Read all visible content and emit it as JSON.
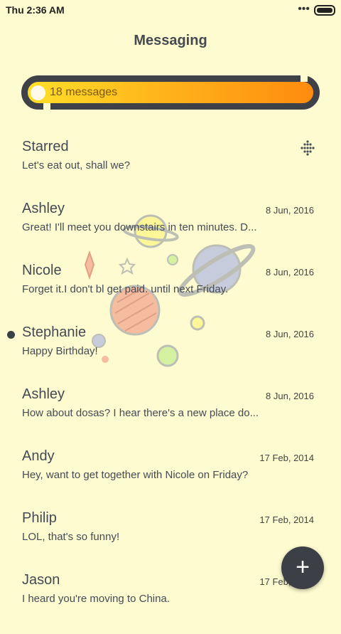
{
  "status": {
    "time": "Thu 2:36 AM",
    "more_glyph": "•••"
  },
  "header": {
    "title": "Messaging"
  },
  "summary": {
    "count_label": "18 messages"
  },
  "conversations": [
    {
      "name": "Starred",
      "preview": "Let's eat out, shall we?",
      "date": "",
      "icon": "dot-grid-icon"
    },
    {
      "name": "Ashley",
      "preview": "Great! I'll meet you downstairs in ten minutes. D...",
      "date": "8 Jun, 2016"
    },
    {
      "name": "Nicole",
      "preview": "Forget it.I don't bl get paid. until next Friday.",
      "date": "8 Jun, 2016"
    },
    {
      "name": "Stephanie",
      "preview": "Happy Birthday!",
      "date": "8 Jun, 2016",
      "unread": true
    },
    {
      "name": "Ashley",
      "preview": "How about dosas? I hear there's a new place do...",
      "date": "8 Jun, 2016"
    },
    {
      "name": "Andy",
      "preview": "Hey, want to get together with Nicole on Friday?",
      "date": "17 Feb, 2014"
    },
    {
      "name": "Philip",
      "preview": "LOL, that's so funny!",
      "date": "17 Feb, 2014"
    },
    {
      "name": "Jason",
      "preview": "I heard you're moving to China.",
      "date": "17 Feb, 2014"
    }
  ],
  "fab": {
    "glyph": "+"
  },
  "colors": {
    "background": "#fdfbcf",
    "accent_start": "#ffdf2a",
    "accent_end": "#ff8b0f",
    "dark": "#3f4148"
  }
}
